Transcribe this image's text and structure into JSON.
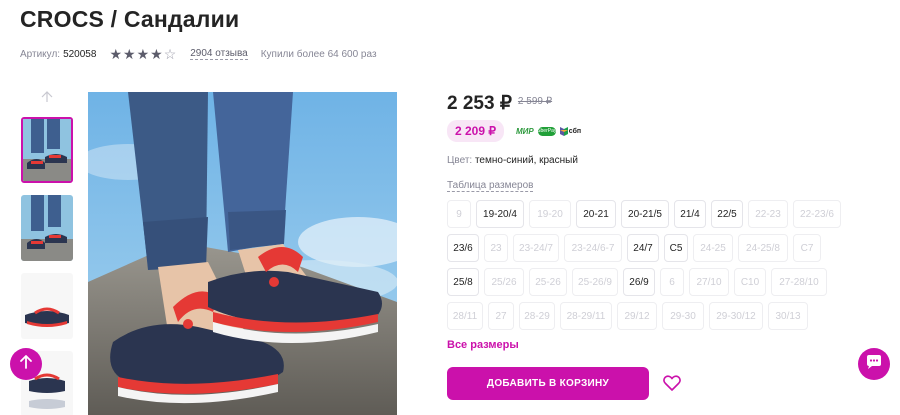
{
  "product": {
    "title": "CROCS / Сандалии",
    "article_label": "Артикул:",
    "article_value": "520058",
    "rating": 4,
    "rating_max": 5,
    "reviews": "2904 отзыва",
    "bought": "Купили более 64 600 раз"
  },
  "pricing": {
    "price": "2 253 ₽",
    "old_price": "2 599 ₽",
    "wallet_price": "2 209 ₽",
    "payment_mir": "МИР",
    "payment_sber": "SberPay",
    "payment_sbp": "сбп"
  },
  "color": {
    "label": "Цвет:",
    "value": "темно-синий, красный"
  },
  "size_table_link": "Таблица размеров",
  "sizes": [
    [
      {
        "label": "9",
        "available": false
      },
      {
        "label": "19-20/4",
        "available": true
      },
      {
        "label": "19-20",
        "available": false
      },
      {
        "label": "20-21",
        "available": true
      },
      {
        "label": "20-21/5",
        "available": true
      },
      {
        "label": "21/4",
        "available": true
      },
      {
        "label": "22/5",
        "available": true
      },
      {
        "label": "22-23",
        "available": false
      },
      {
        "label": "22-23/6",
        "available": false
      }
    ],
    [
      {
        "label": "23/6",
        "available": true
      },
      {
        "label": "23",
        "available": false
      },
      {
        "label": "23-24/7",
        "available": false
      },
      {
        "label": "23-24/6-7",
        "available": false
      },
      {
        "label": "24/7",
        "available": true
      },
      {
        "label": "C5",
        "available": true
      },
      {
        "label": "24-25",
        "available": false
      },
      {
        "label": "24-25/8",
        "available": false
      },
      {
        "label": "C7",
        "available": false
      }
    ],
    [
      {
        "label": "25/8",
        "available": true
      },
      {
        "label": "25/26",
        "available": false
      },
      {
        "label": "25-26",
        "available": false
      },
      {
        "label": "25-26/9",
        "available": false
      },
      {
        "label": "26/9",
        "available": true
      },
      {
        "label": "6",
        "available": false
      },
      {
        "label": "27/10",
        "available": false
      },
      {
        "label": "C10",
        "available": false
      },
      {
        "label": "27-28/10",
        "available": false
      }
    ],
    [
      {
        "label": "28/11",
        "available": false
      },
      {
        "label": "27",
        "available": false
      },
      {
        "label": "28-29",
        "available": false
      },
      {
        "label": "28-29/11",
        "available": false
      },
      {
        "label": "29/12",
        "available": false
      },
      {
        "label": "29-30",
        "available": false
      },
      {
        "label": "29-30/12",
        "available": false
      },
      {
        "label": "30/13",
        "available": false
      }
    ]
  ],
  "all_sizes": "Все размеры",
  "add_to_cart": "ДОБАВИТЬ В КОРЗИНУ",
  "icons": {
    "star": "star-icon",
    "gallery_up": "arrow-up-icon",
    "scroll_top": "arrow-up-icon",
    "chat": "chat-icon",
    "wishlist": "heart-icon"
  },
  "colors": {
    "accent": "#cb11ab",
    "accent_light": "#f8e6f6",
    "text": "#242424",
    "muted": "#868695"
  }
}
